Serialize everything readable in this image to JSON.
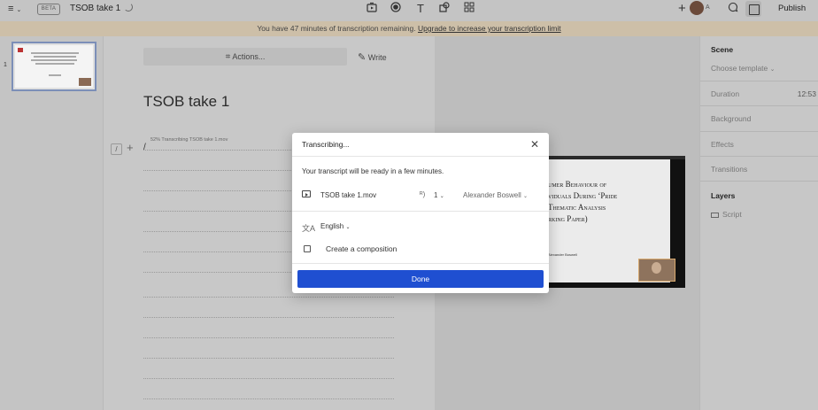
{
  "topbar": {
    "menu_icon": "≡",
    "beta_badge": "BETA",
    "doc_title": "TSOB take 1",
    "avatar_initial": "A",
    "publish_label": "Publish"
  },
  "banner": {
    "text": "You have 47 minutes of transcription remaining.",
    "link": "Upgrade to increase your transcription limit"
  },
  "sidebar": {
    "scene_number": "1"
  },
  "editor": {
    "actions_label": "Actions...",
    "write_label": "Write",
    "script_title": "TSOB take 1",
    "slash_label": "/",
    "cursor": "/",
    "progress_text": "52% Transcribing TSOB take 1.mov"
  },
  "preview": {
    "slide_lines": [
      "umer Behaviour of",
      "viduals During ‘Pride",
      "Thematic Analysis",
      "rking Paper)"
    ],
    "slide_author": "Alexander Boswell"
  },
  "right_panel": {
    "scene_heading": "Scene",
    "choose_template": "Choose template",
    "duration_label": "Duration",
    "duration_value": "12:53",
    "background_label": "Background",
    "effects_label": "Effects",
    "transitions_label": "Transitions",
    "layers_heading": "Layers",
    "script_layer": "Script"
  },
  "modal": {
    "title": "Transcribing...",
    "message": "Your transcript will be ready in a few minutes.",
    "file_name": "TSOB take 1.mov",
    "speaker_count": "1",
    "speaker_name": "Alexander Boswell",
    "language": "English",
    "composition_label": "Create a composition",
    "done_label": "Done"
  }
}
